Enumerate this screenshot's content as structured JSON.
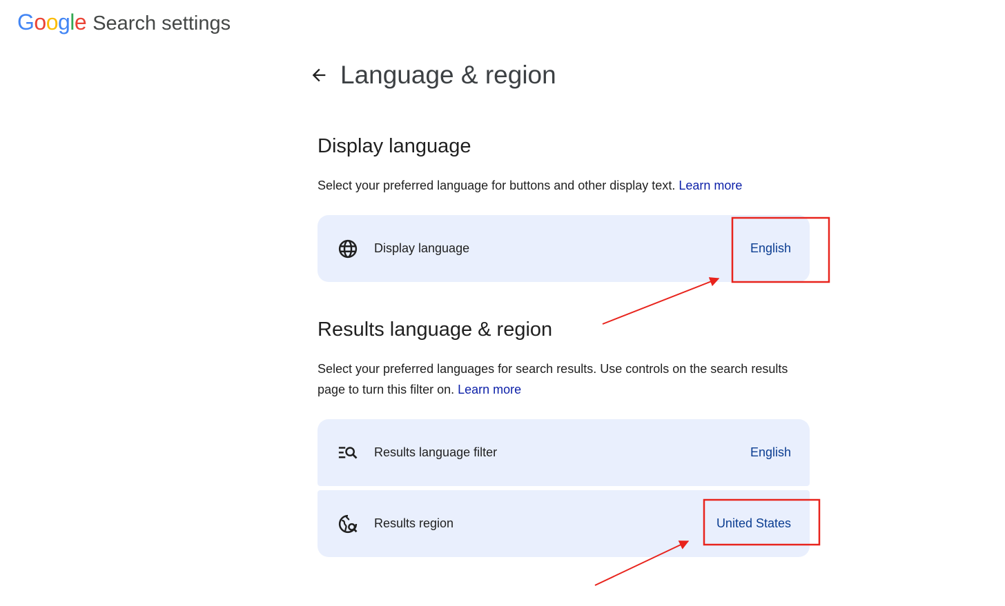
{
  "header": {
    "logo_letters": [
      "G",
      "o",
      "o",
      "g",
      "l",
      "e"
    ],
    "title": "Search settings"
  },
  "page": {
    "title": "Language & region"
  },
  "display_language": {
    "heading": "Display language",
    "description": "Select your preferred language for buttons and other display text.",
    "learn_more": "Learn more",
    "row": {
      "label": "Display language",
      "value": "English",
      "icon": "globe-icon"
    }
  },
  "results": {
    "heading": "Results language & region",
    "description": "Select your preferred languages for search results. Use controls on the search results page to turn this filter on.",
    "learn_more": "Learn more",
    "rows": [
      {
        "label": "Results language filter",
        "value": "English",
        "icon": "filter-search-icon"
      },
      {
        "label": "Results region",
        "value": "United States",
        "icon": "globe-search-icon"
      }
    ]
  },
  "colors": {
    "card_bg": "#e9effd",
    "link": "#0b1fa8",
    "value": "#0b3d91",
    "annotation": "#e8231c",
    "logo": [
      "#4285F4",
      "#EA4335",
      "#FBBC05",
      "#4285F4",
      "#34A853",
      "#EA4335"
    ]
  }
}
